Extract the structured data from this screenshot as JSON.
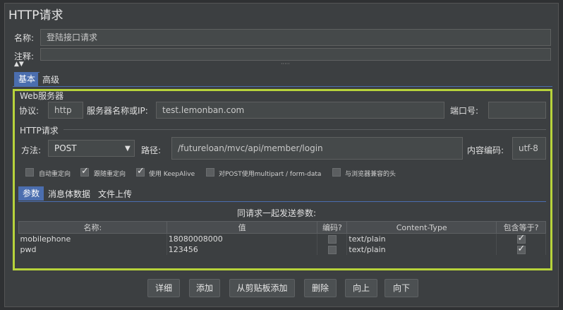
{
  "title": "HTTP请求",
  "name_label": "名称:",
  "name_value": "登陆接口请求",
  "comment_label": "注释:",
  "collapse_dots": "·····",
  "tabs": {
    "basic": "基本",
    "advanced": "高级"
  },
  "web_server": {
    "legend": "Web服务器",
    "protocol_label": "协议:",
    "protocol_value": "http",
    "server_label": "服务器名称或IP:",
    "server_value": "test.lemonban.com",
    "port_label": "端口号:",
    "port_value": ""
  },
  "http_request": {
    "legend": "HTTP请求",
    "method_label": "方法:",
    "method_value": "POST",
    "path_label": "路径:",
    "path_value": "/futureloan/mvc/api/member/login",
    "encoding_label": "内容编码:",
    "encoding_value": "utf-8"
  },
  "options": [
    {
      "label": "自动重定向",
      "checked": false
    },
    {
      "label": "跟随重定向",
      "checked": true
    },
    {
      "label": "使用 KeepAlive",
      "checked": true
    },
    {
      "label": "对POST使用multipart / form-data",
      "checked": false
    },
    {
      "label": "与浏览器兼容的头",
      "checked": false
    }
  ],
  "sub_tabs": {
    "params": "参数",
    "body": "消息体数据",
    "files": "文件上传"
  },
  "params_title": "同请求一起发送参数:",
  "params_headers": [
    "名称:",
    "值",
    "编码?",
    "Content-Type",
    "包含等于?"
  ],
  "params_rows": [
    {
      "name": "mobilephone",
      "value": "18080008000",
      "encode": false,
      "content_type": "text/plain",
      "include_equals": true
    },
    {
      "name": "pwd",
      "value": "123456",
      "encode": false,
      "content_type": "text/plain",
      "include_equals": true
    }
  ],
  "buttons": {
    "detail": "详细",
    "add": "添加",
    "paste": "从剪贴板添加",
    "delete": "删除",
    "up": "向上",
    "down": "向下"
  },
  "colors": {
    "highlight_border": "#b7d33b",
    "active_tab": "#4b6eaf",
    "background": "#3c3f41"
  }
}
